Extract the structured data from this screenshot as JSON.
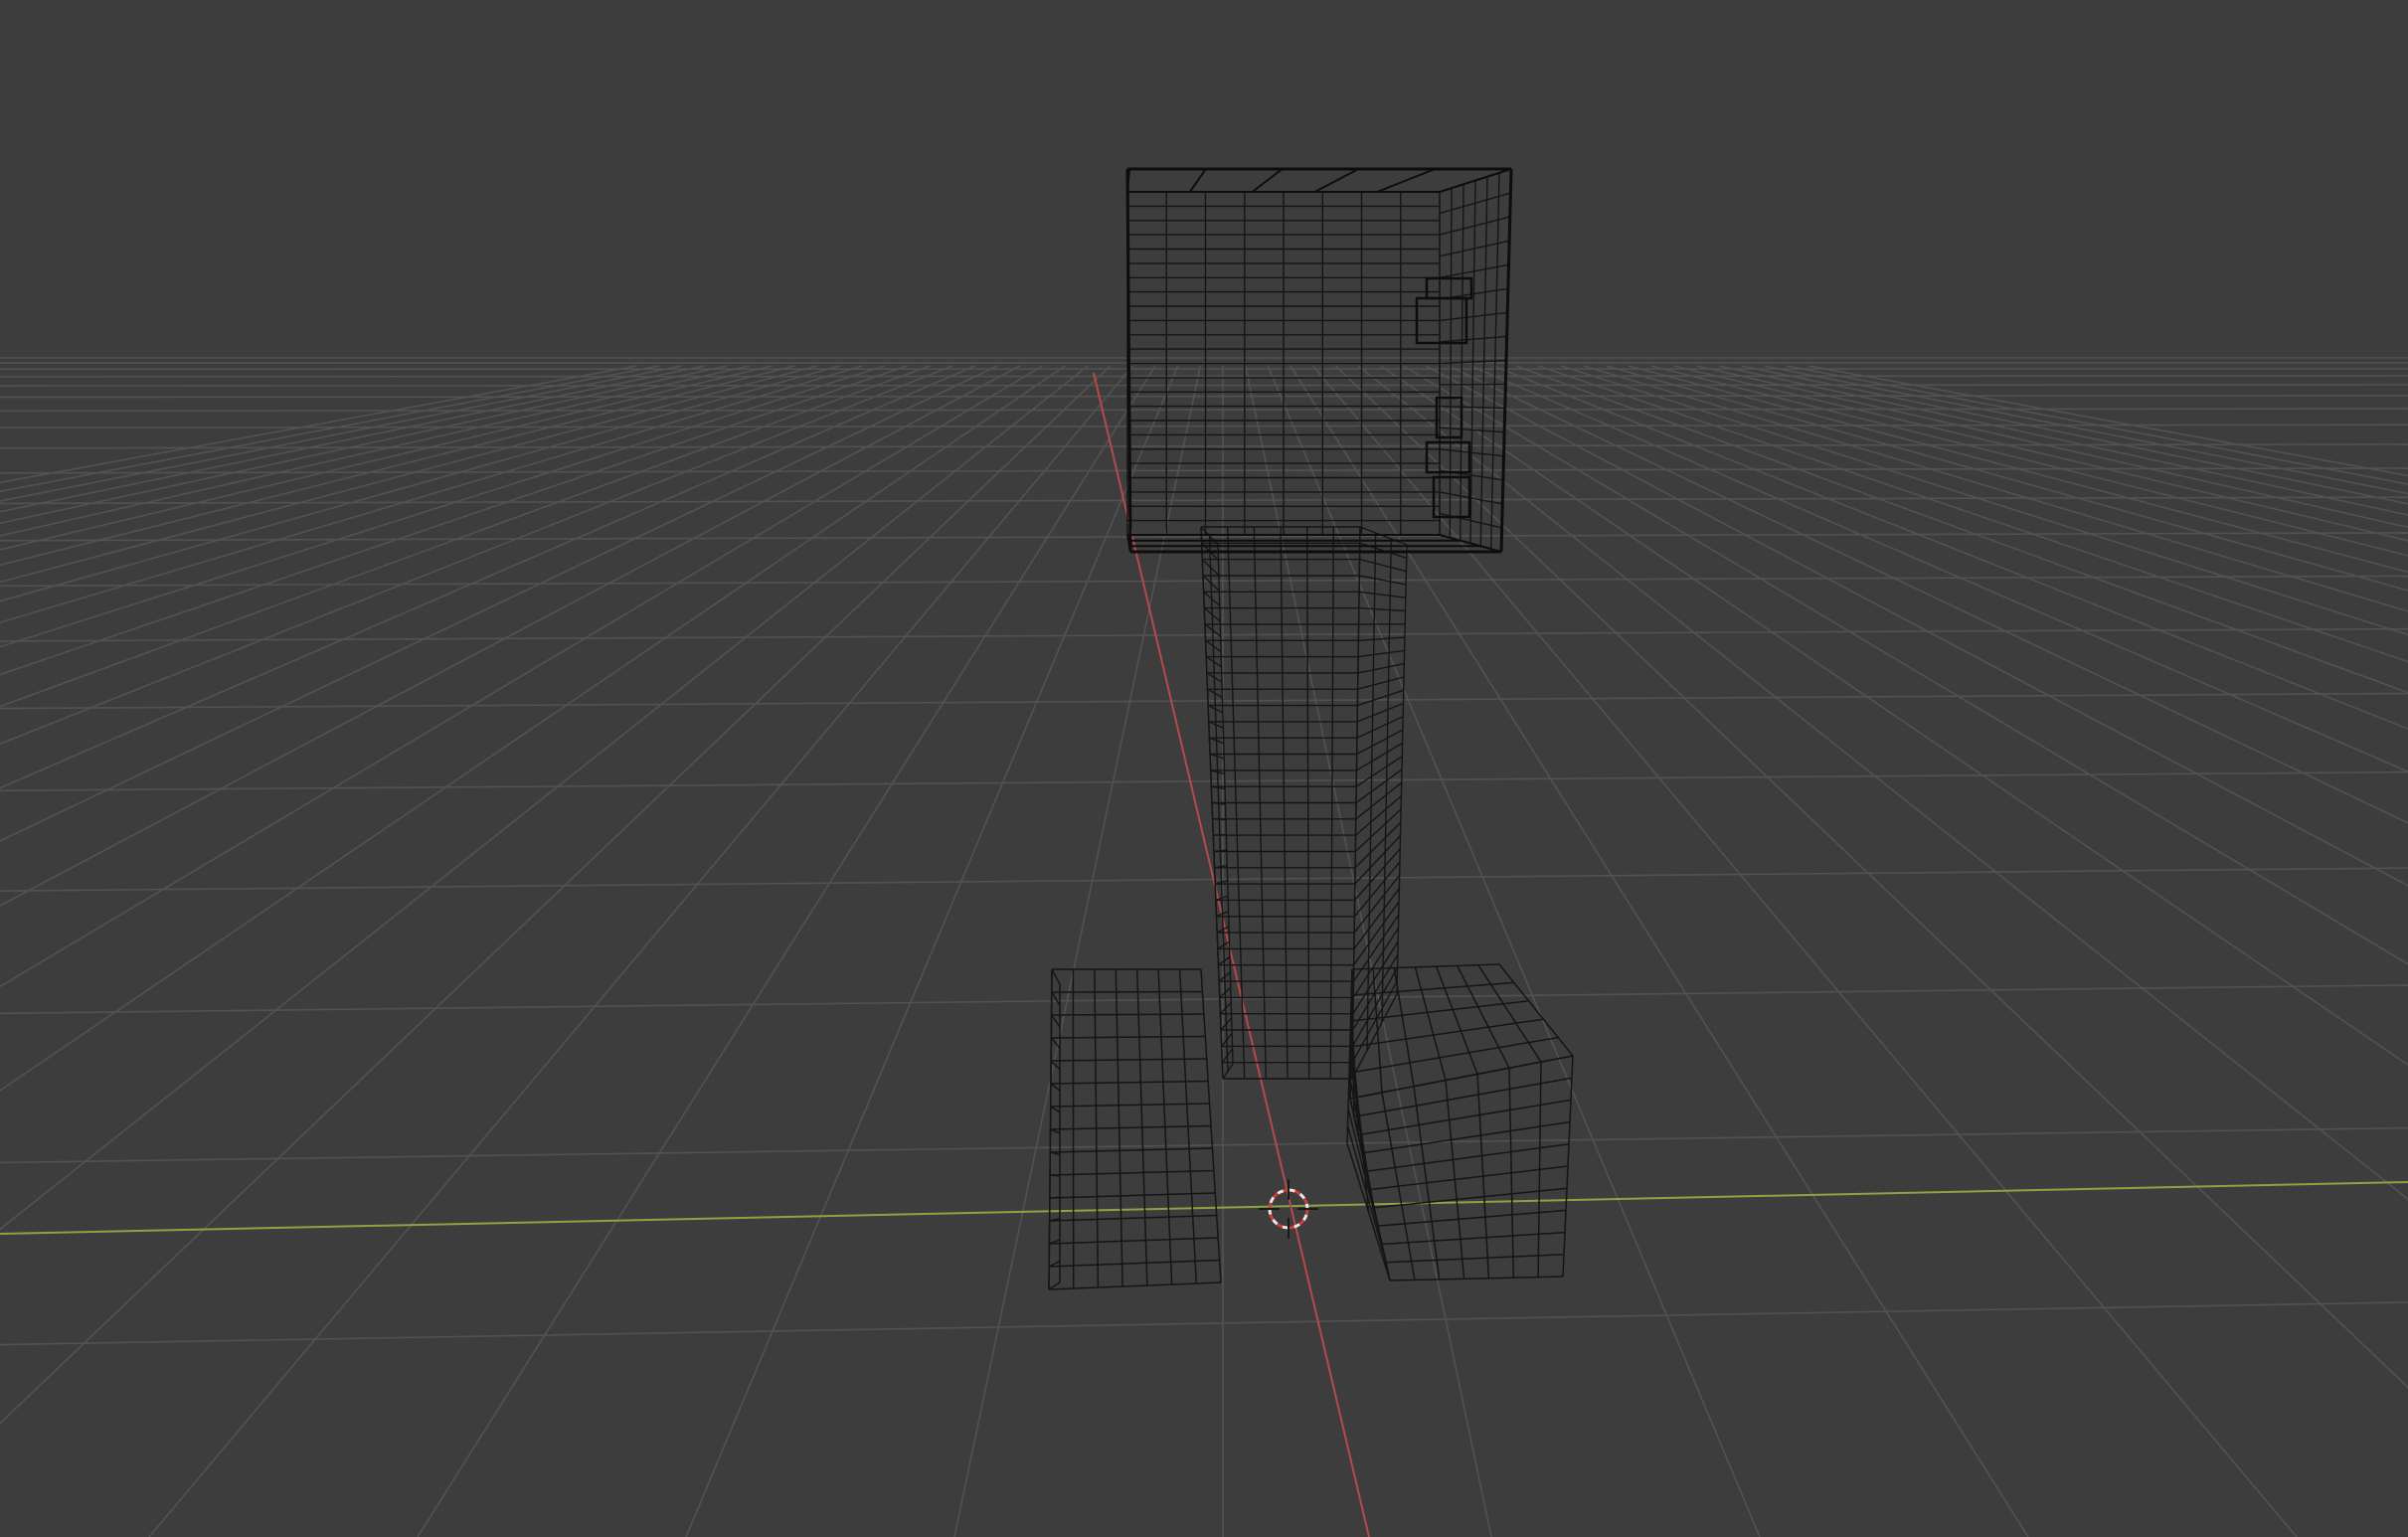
{
  "app": {
    "name": "3D viewport",
    "shading_mode": "wireframe"
  },
  "colors": {
    "background": "#3d3d3d",
    "grid_line": "#525252",
    "x_axis": "#8aa442",
    "y_axis": "#b54a4a",
    "wire": "#151515",
    "wire_dense": "#0d0d0d",
    "cursor_ring": "#e8e8e8",
    "cursor_dash": "#d43a3a"
  },
  "scene": {
    "object": "creeper-wireframe",
    "parts": [
      "head",
      "body",
      "front-left-leg",
      "front-right-leg"
    ],
    "cursor_icon": "3d-cursor-icon"
  }
}
